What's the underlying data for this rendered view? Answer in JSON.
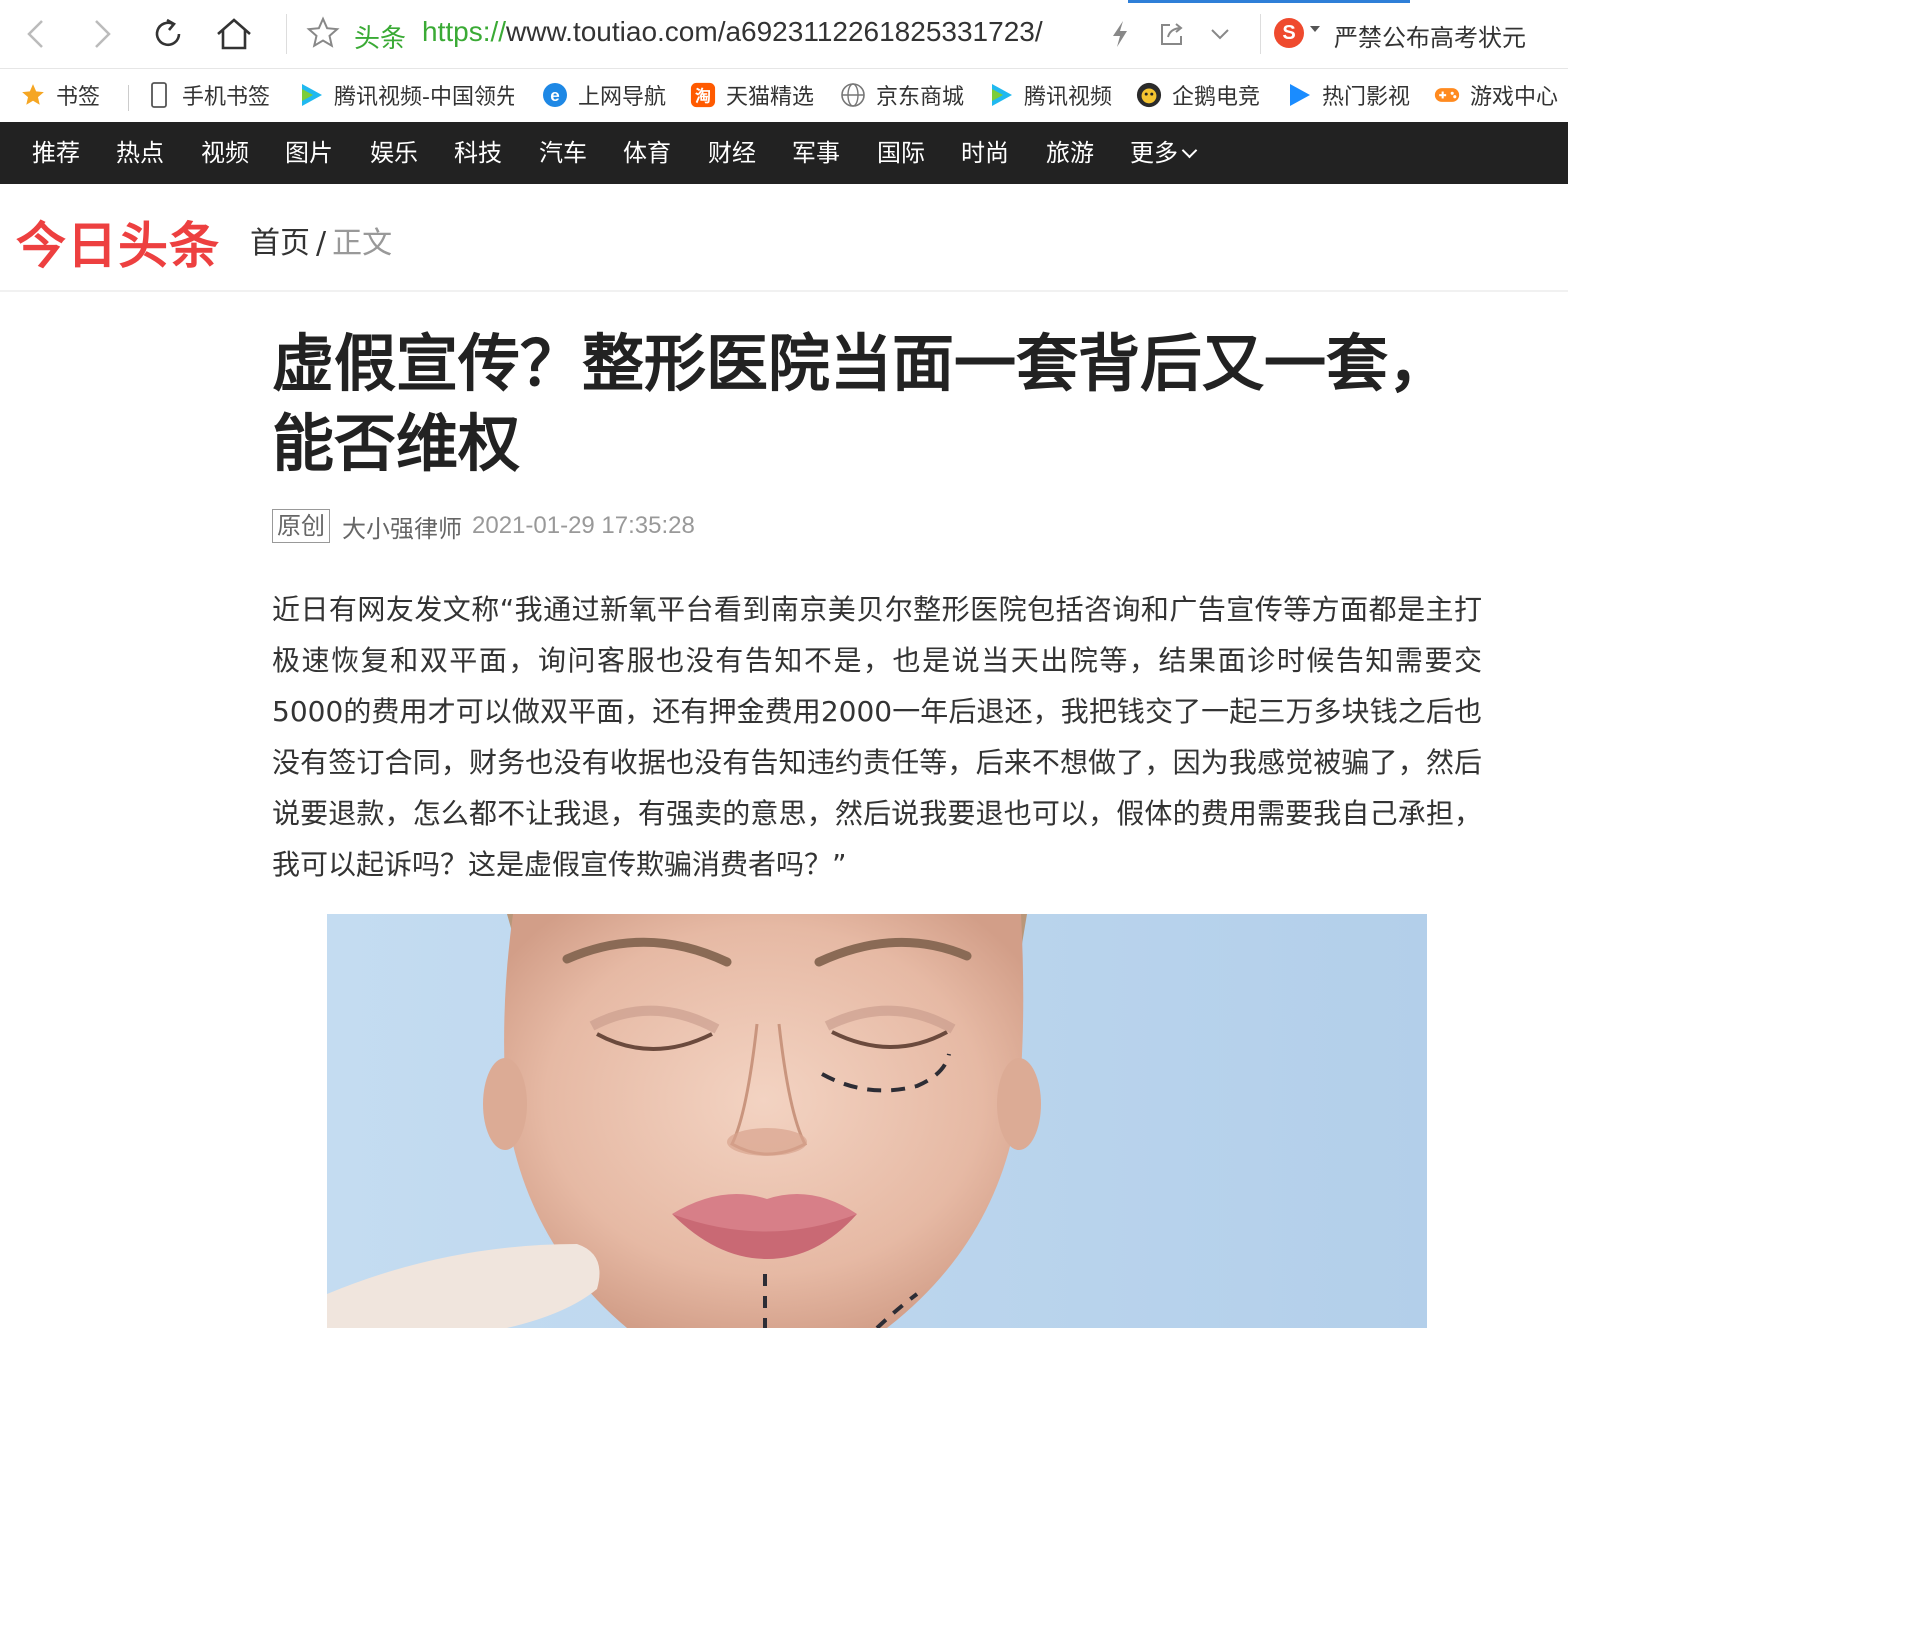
{
  "browser": {
    "address_tag": "头条",
    "url_scheme": "https://",
    "url_rest": "www.toutiao.com/a6923112261825331723/",
    "search_logo": "S",
    "hot_search": "严禁公布高考状元"
  },
  "bookmarks": [
    {
      "label": "书签",
      "icon": "star-icon"
    },
    {
      "label": "手机书签",
      "icon": "phone-icon"
    },
    {
      "label": "腾讯视频-中国领先",
      "icon": "tencent-video-icon"
    },
    {
      "label": "上网导航",
      "icon": "ie-icon"
    },
    {
      "label": "天猫精选",
      "icon": "tmall-icon"
    },
    {
      "label": "京东商城",
      "icon": "globe-icon"
    },
    {
      "label": "腾讯视频",
      "icon": "tencent-video-icon"
    },
    {
      "label": "企鹅电竞",
      "icon": "penguin-esports-icon"
    },
    {
      "label": "热门影视",
      "icon": "play-icon"
    },
    {
      "label": "游戏中心",
      "icon": "gamepad-icon"
    }
  ],
  "channels": [
    "推荐",
    "热点",
    "视频",
    "图片",
    "娱乐",
    "科技",
    "汽车",
    "体育",
    "财经",
    "军事",
    "国际",
    "时尚",
    "旅游",
    "更多"
  ],
  "site": {
    "logo": "今日头条",
    "crumb_home": "首页",
    "crumb_sep": "/",
    "crumb_current": "正文"
  },
  "article": {
    "title": "虚假宣传？整形医院当面一套背后又一套，能否维权",
    "badge": "原创",
    "author": "大小强律师",
    "time": "2021-01-29 17:35:28",
    "body": "近日有网友发文称“我通过新氧平台看到南京美贝尔整形医院包括咨询和广告宣传等方面都是主打极速恢复和双平面，询问客服也没有告知不是，也是说当天出院等，结果面诊时候告知需要交5000的费用才可以做双平面，还有押金费用2000一年后退还，我把钱交了一起三万多块钱之后也没有签订合同，财务也没有收据也没有告知违约责任等，后来不想做了，因为我感觉被骗了，然后说要退款，怎么都不让我退，有强卖的意思，然后说我要退也可以，假体的费用需要我自己承担，我可以起诉吗？这是虚假宣传欺骗消费者吗？”"
  },
  "colors": {
    "brand_red": "#ed4040",
    "nav_bg": "#222222",
    "url_green": "#3aaa35",
    "photo_bg": "#bcd7ef"
  }
}
